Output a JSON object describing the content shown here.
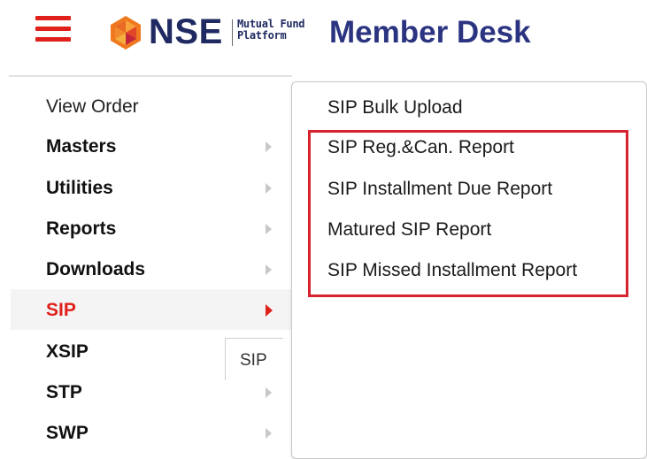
{
  "header": {
    "brand": "NSE",
    "brand_sub_line1": "Mutual Fund",
    "brand_sub_line2": "Platform",
    "app_title": "Member Desk",
    "accent_color": "#e0201b",
    "brand_color": "#1f2a62"
  },
  "left_menu": {
    "items": [
      {
        "label": "View Order"
      },
      {
        "label": "Masters"
      },
      {
        "label": "Utilities"
      },
      {
        "label": "Reports"
      },
      {
        "label": "Downloads"
      },
      {
        "label": "SIP"
      },
      {
        "label": "XSIP"
      },
      {
        "label": "STP"
      },
      {
        "label": "SWP"
      }
    ],
    "active_item": "SIP",
    "tooltip": "SIP"
  },
  "submenu": {
    "items": [
      {
        "label": "SIP Bulk Upload"
      },
      {
        "label": "SIP Reg.&Can. Report"
      },
      {
        "label": "SIP Installment Due Report"
      },
      {
        "label": "Matured SIP Report"
      },
      {
        "label": "SIP Missed Installment Report"
      }
    ],
    "highlight_color": "#d6232f"
  }
}
